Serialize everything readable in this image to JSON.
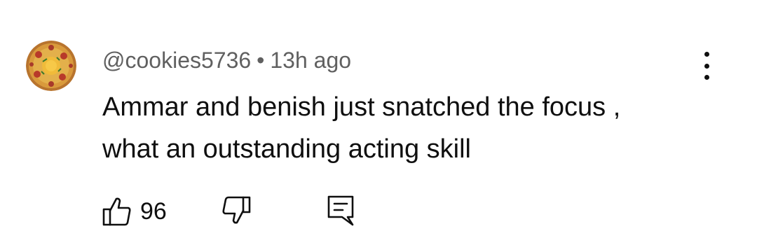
{
  "comment": {
    "author": "@cookies5736",
    "separator": "•",
    "timestamp": "13h ago",
    "text_lines": [
      "Ammar and benish just snatched the focus ,",
      "what an outstanding acting skill"
    ],
    "like_count": "96",
    "avatar_icon": "pizza-avatar",
    "more_icon": "vertical-ellipsis-icon",
    "like_icon": "thumbs-up-outline-icon",
    "dislike_icon": "thumbs-down-outline-icon",
    "reply_icon": "comment-reply-icon"
  },
  "colors": {
    "text_primary": "#0f0f0f",
    "text_secondary": "#606060",
    "background": "#ffffff"
  }
}
